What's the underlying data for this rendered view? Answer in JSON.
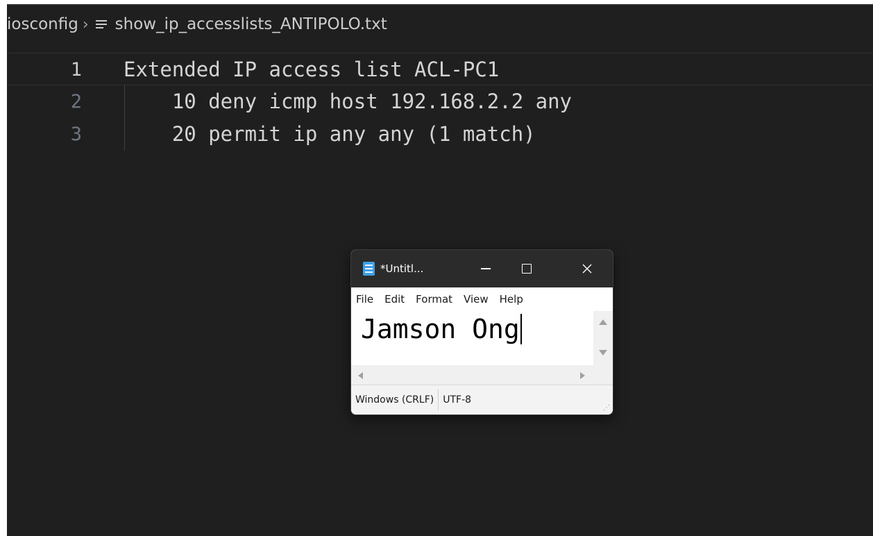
{
  "breadcrumb": {
    "folder": "iosconfig",
    "separator": "›",
    "file_icon": "text-file-icon",
    "file": "show_ip_accesslists_ANTIPOLO.txt"
  },
  "editor": {
    "lines": [
      {
        "number": "1",
        "text": "Extended IP access list ACL-PC1"
      },
      {
        "number": "2",
        "text": "    10 deny icmp host 192.168.2.2 any"
      },
      {
        "number": "3",
        "text": "    20 permit ip any any (1 match)"
      }
    ]
  },
  "notepad": {
    "app_icon": "notepad-icon",
    "title": "*Untitl...",
    "minimize_icon": "minimize-icon",
    "maximize_icon": "maximize-icon",
    "close_icon": "close-icon",
    "menu": {
      "file": "File",
      "edit": "Edit",
      "format": "Format",
      "view": "View",
      "help": "Help"
    },
    "content": "Jamson Ong",
    "status": {
      "line_ending": "Windows (CRLF)",
      "encoding": "UTF-8"
    }
  },
  "colors": {
    "editor_bg": "#1f1f1f",
    "notepad_titlebar": "#2b2b2b",
    "notepad_icon": "#3fa0e6"
  }
}
